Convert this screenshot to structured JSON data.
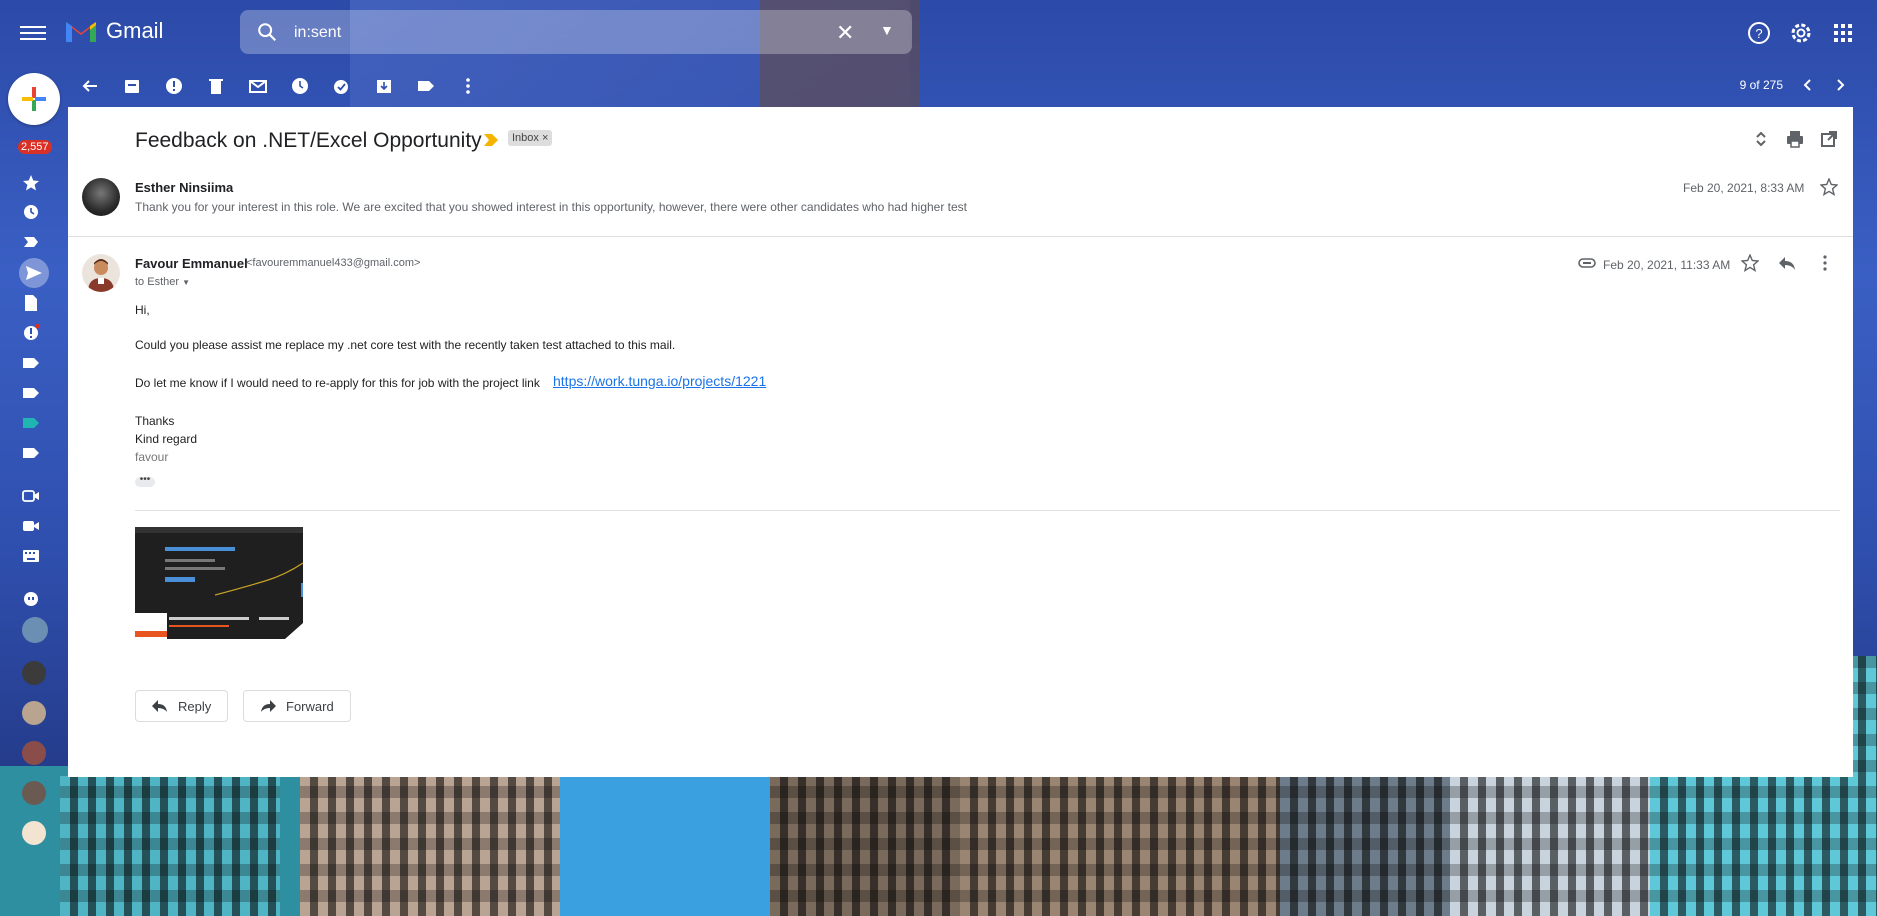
{
  "app": {
    "name": "Gmail"
  },
  "search": {
    "value": "in:sent"
  },
  "nav": {
    "unread_badge": "2,557"
  },
  "pager": {
    "text": "9 of 275"
  },
  "thread": {
    "subject": "Feedback on .NET/Excel Opportunity",
    "label_chip": "Inbox",
    "label_chip_close": "×"
  },
  "message1": {
    "sender": "Esther Ninsiima",
    "snippet": "Thank you for your interest in this role. We are excited that you showed interest in this opportunity, however, there were other candidates who had higher test",
    "date": "Feb 20, 2021, 8:33 AM"
  },
  "message2": {
    "sender": "Favour Emmanuel",
    "email": "<favouremmanuel433@gmail.com>",
    "to": "to Esther",
    "date": "Feb 20, 2021, 11:33 AM",
    "body": {
      "greeting": "Hi,",
      "line1": "Could you please assist me replace my .net core test with the recently taken test attached to this mail.",
      "line2": "Do let me know if I would need to re-apply for this for job with the project link",
      "link": "https://work.tunga.io/projects/1221",
      "thanks": "Thanks",
      "regard": "Kind regard",
      "signature": "favour",
      "more": "•••"
    }
  },
  "actions": {
    "reply": "Reply",
    "forward": "Forward"
  },
  "colors": {
    "badge": "#d93025",
    "link": "#1a73e8",
    "label_arrow": "#f5b400"
  }
}
